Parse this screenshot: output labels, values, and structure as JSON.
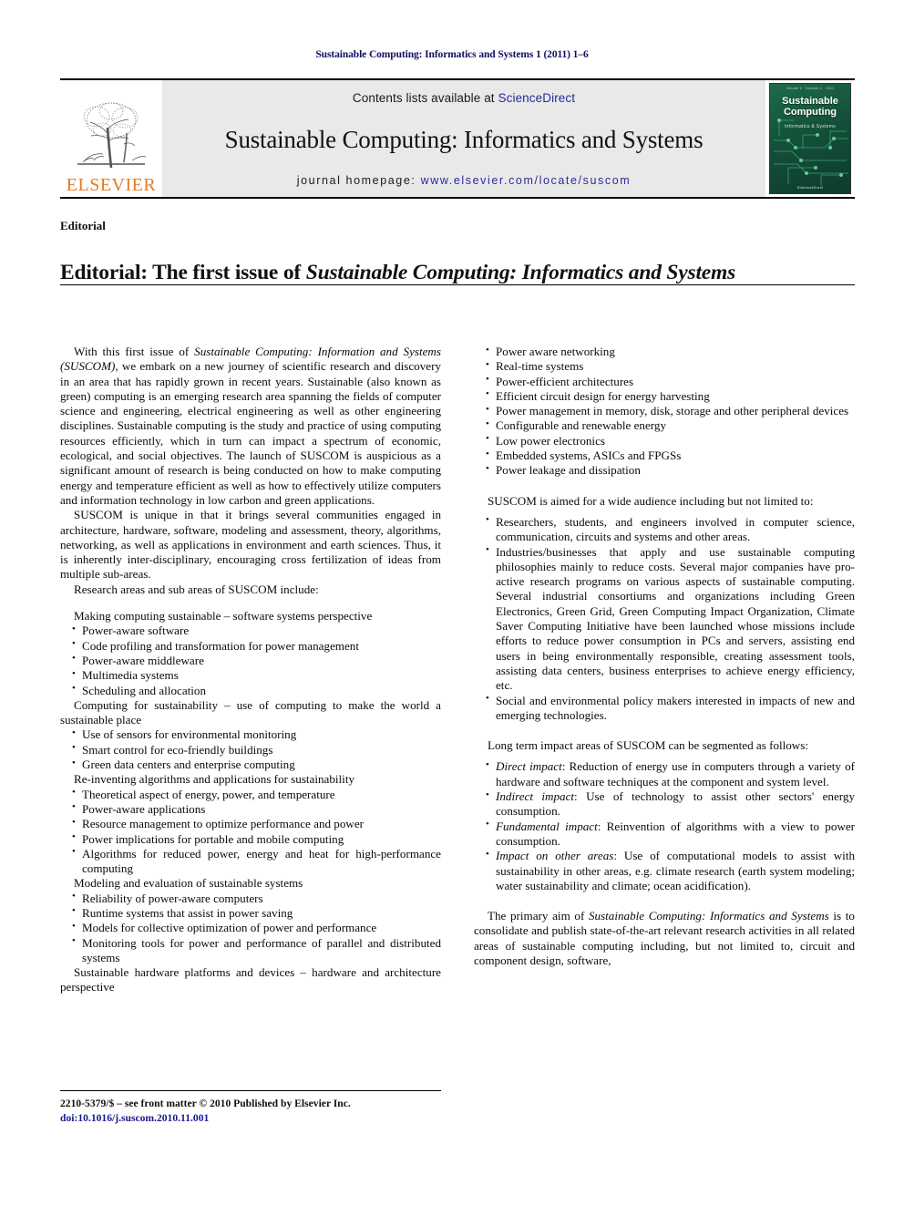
{
  "running_head": "Sustainable Computing: Informatics and Systems 1 (2011) 1–6",
  "masthead": {
    "publisher": "ELSEVIER",
    "contents_prefix": "Contents lists available at ",
    "contents_link": "ScienceDirect",
    "journal_title": "Sustainable Computing: Informatics and Systems",
    "homepage_prefix": "journal homepage: ",
    "homepage_url": "www.elsevier.com/locate/suscom",
    "cover": {
      "top_line": "Volume 1 · Number 1 · 2011",
      "title_line1": "Sustainable",
      "title_line2": "Computing",
      "subtitle": "Informatics & Systems",
      "bottom_line": "ScienceDirect"
    },
    "link_color": "#2a2a9c",
    "brand_color": "#E87B1E"
  },
  "article": {
    "section_label": "Editorial",
    "title_prefix": "Editorial: The first issue of ",
    "title_italic": "Sustainable Computing: Informatics and Systems"
  },
  "left_column": {
    "paragraphs": [
      {
        "segments": [
          {
            "text": "With this first issue of ",
            "style": "normal"
          },
          {
            "text": "Sustainable Computing: Information and Systems (SUSCOM)",
            "style": "italic"
          },
          {
            "text": ", we embark on a new journey of scientific research and discovery in an area that has rapidly grown in recent years. Sustainable (also known as green) computing is an emerging research area spanning the fields of computer science and engineering, electrical engineering as well as other engineering disciplines. Sustainable computing is the study and practice of using computing resources efficiently, which in turn can impact a spectrum of economic, ecological, and social objectives. The launch of SUSCOM is auspicious as a significant amount of research is being conducted on how to make computing energy and temperature efficient as well as how to effectively utilize computers and information technology in low carbon and green applications.",
            "style": "normal"
          }
        ]
      },
      {
        "segments": [
          {
            "text": "SUSCOM is unique in that it brings several communities engaged in architecture, hardware, software, modeling and assessment, theory, algorithms, networking, as well as applications in environment and earth sciences. Thus, it is inherently inter-disciplinary, encouraging cross fertilization of ideas from multiple sub-areas.",
            "style": "normal"
          }
        ]
      },
      {
        "segments": [
          {
            "text": "Research areas and sub areas of SUSCOM include:",
            "style": "normal"
          }
        ]
      }
    ],
    "groups": [
      {
        "heading": "Making computing sustainable – software systems perspective",
        "items": [
          "Power-aware software",
          "Code profiling and transformation for power management",
          "Power-aware middleware",
          "Multimedia systems",
          "Scheduling and allocation"
        ]
      },
      {
        "heading": "Computing for sustainability – use of computing to make the world a sustainable place",
        "items": [
          "Use of sensors for environmental monitoring",
          "Smart control for eco-friendly buildings",
          "Green data centers and enterprise computing"
        ]
      },
      {
        "heading": "Re-inventing algorithms and applications for sustainability",
        "items": [
          "Theoretical aspect of energy, power, and temperature",
          "Power-aware applications",
          "Resource management to optimize performance and power",
          "Power implications for portable and mobile computing",
          "Algorithms for reduced power, energy and heat for high-performance computing"
        ]
      },
      {
        "heading": "Modeling and evaluation of sustainable systems",
        "items": [
          "Reliability of power-aware computers",
          "Runtime systems that assist in power saving",
          "Models for collective optimization of power and performance",
          "Monitoring tools for power and performance of parallel and distributed systems"
        ]
      },
      {
        "heading": "Sustainable hardware platforms and devices – hardware and architecture perspective",
        "items": []
      }
    ]
  },
  "right_column": {
    "hardware_items": [
      "Power aware networking",
      "Real-time systems",
      "Power-efficient architectures",
      "Efficient circuit design for energy harvesting",
      "Power management in memory, disk, storage and other peripheral devices",
      "Configurable and renewable energy",
      "Low power electronics",
      "Embedded systems, ASICs and FPGSs",
      "Power leakage and dissipation"
    ],
    "audience_intro": "SUSCOM is aimed for a wide audience including but not limited to:",
    "audience_items": [
      {
        "segments": [
          {
            "text": "Researchers, students, and engineers involved in computer science, communication, circuits and systems and other areas.",
            "style": "normal"
          }
        ]
      },
      {
        "segments": [
          {
            "text": "Industries/businesses that apply and use sustainable computing philosophies mainly to reduce costs. Several major companies have pro-active research programs on various aspects of sustainable computing. Several industrial consortiums and organizations including Green Electronics, Green Grid, Green Computing Impact Organization, Climate Saver Computing Initiative have been launched whose missions include efforts to reduce power consumption in PCs and servers, assisting end users in being environmentally responsible, creating assessment tools, assisting data centers, business enterprises to achieve energy efficiency, etc.",
            "style": "normal"
          }
        ]
      },
      {
        "segments": [
          {
            "text": "Social and environmental policy makers interested in impacts of new and emerging technologies.",
            "style": "normal"
          }
        ]
      }
    ],
    "impact_intro": "Long term impact areas of SUSCOM can be segmented as follows:",
    "impact_items": [
      {
        "segments": [
          {
            "text": "Direct impact",
            "style": "italic"
          },
          {
            "text": ": Reduction of energy use in computers through a variety of hardware and software techniques at the component and system level.",
            "style": "normal"
          }
        ]
      },
      {
        "segments": [
          {
            "text": "Indirect impact",
            "style": "italic"
          },
          {
            "text": ": Use of technology to assist other sectors' energy consumption.",
            "style": "normal"
          }
        ]
      },
      {
        "segments": [
          {
            "text": "Fundamental impact",
            "style": "italic"
          },
          {
            "text": ": Reinvention of algorithms with a view to power consumption.",
            "style": "normal"
          }
        ]
      },
      {
        "segments": [
          {
            "text": "Impact on other areas",
            "style": "italic"
          },
          {
            "text": ": Use of computational models to assist with sustainability in other areas, e.g. climate research (earth system modeling; water sustainability and climate; ocean acidification).",
            "style": "normal"
          }
        ]
      }
    ],
    "closing_paragraph": {
      "segments": [
        {
          "text": "The primary aim of ",
          "style": "normal"
        },
        {
          "text": "Sustainable Computing: Informatics and Systems",
          "style": "italic"
        },
        {
          "text": " is to consolidate and publish state-of-the-art relevant research activities in all related areas of sustainable computing including, but not limited to, circuit and component design, software,",
          "style": "normal"
        }
      ]
    }
  },
  "footer": {
    "front_matter": "2210-5379/$ – see front matter © 2010 Published by Elsevier Inc.",
    "doi": "doi:10.1016/j.suscom.2010.11.001"
  }
}
